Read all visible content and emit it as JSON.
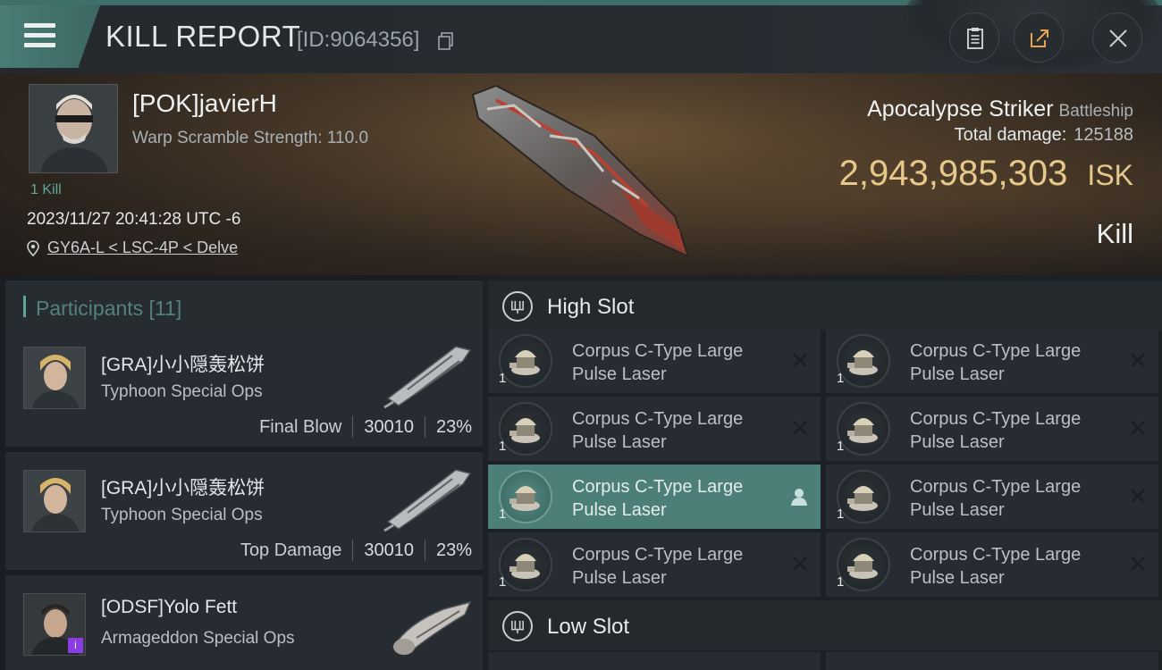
{
  "header": {
    "title": "KILL REPORT",
    "report_id": "[ID:9064356]"
  },
  "victim": {
    "name": "[POK]javierH",
    "warp_scramble": "Warp Scramble Strength: 110.0",
    "kill_count": "1 Kill",
    "datetime": "2023/11/27 20:41:28 UTC -6",
    "location": "GY6A-L < LSC-4P < Delve",
    "ship_name": "Apocalypse Striker",
    "ship_class": "Battleship",
    "total_damage_label": "Total damage:",
    "total_damage": "125188",
    "isk_value": "2,943,985,303",
    "isk_unit": "ISK",
    "result": "Kill"
  },
  "participants": {
    "title": "Participants [11]",
    "rows": [
      {
        "name": "[GRA]小小隠轰松饼",
        "ship": "Typhoon Special Ops",
        "role": "Final Blow",
        "damage": "30010",
        "percent": "23%"
      },
      {
        "name": "[GRA]小小隠轰松饼",
        "ship": "Typhoon Special Ops",
        "role": "Top Damage",
        "damage": "30010",
        "percent": "23%"
      },
      {
        "name": "[ODSF]Yolo Fett",
        "ship": "Armageddon Special Ops",
        "badge": "i"
      }
    ]
  },
  "slots": {
    "high_title": "High Slot",
    "low_title": "Low Slot",
    "high_modules": [
      {
        "line1": "Corpus C-Type Large",
        "line2": "Pulse Laser",
        "qty": "1"
      },
      {
        "line1": "Corpus C-Type Large",
        "line2": "Pulse Laser",
        "qty": "1"
      },
      {
        "line1": "Corpus C-Type Large",
        "line2": "Pulse Laser",
        "qty": "1"
      },
      {
        "line1": "Corpus C-Type Large",
        "line2": "Pulse Laser",
        "qty": "1"
      },
      {
        "line1": "Corpus C-Type Large",
        "line2": "Pulse Laser",
        "qty": "1"
      },
      {
        "line1": "Corpus C-Type Large",
        "line2": "Pulse Laser",
        "qty": "1"
      },
      {
        "line1": "Corpus C-Type Large",
        "line2": "Pulse Laser",
        "qty": "1"
      },
      {
        "line1": "Corpus C-Type Large",
        "line2": "Pulse Laser",
        "qty": "1"
      }
    ]
  },
  "colors": {
    "accent": "#4b7f78",
    "isk": "#e6c98a",
    "badge": "#8a3de6"
  }
}
